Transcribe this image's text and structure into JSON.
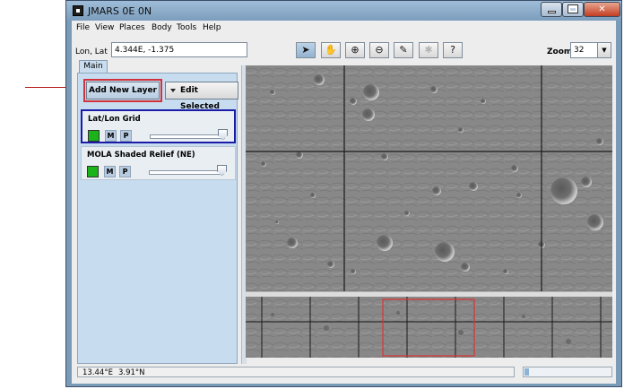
{
  "window": {
    "title": "JMARS 0E 0N"
  },
  "menubar": {
    "items": [
      "File",
      "View",
      "Places",
      "Body",
      "Tools",
      "Help"
    ]
  },
  "toolbar": {
    "lonlat_label": "Lon, Lat",
    "lonlat_value": "4.344E, -1.375",
    "tools": [
      "select-arrow",
      "pan-hand",
      "zoom-in",
      "zoom-out",
      "ruler",
      "disabled-tool",
      "info-query"
    ],
    "zoom_label": "Zoom:",
    "zoom_value": "32"
  },
  "panel": {
    "tab": "Main",
    "add_layer_label": "Add New Layer",
    "edit_selected_label": "Edit Selected",
    "layers": [
      {
        "name": "Lat/Lon Grid",
        "color": "#1ab41a",
        "m": "M",
        "p": "P",
        "opacity": 1.0,
        "selected": true
      },
      {
        "name": "MOLA Shaded Relief (NE)",
        "color": "#1ab41a",
        "m": "M",
        "p": "P",
        "opacity": 1.0,
        "selected": false
      }
    ]
  },
  "status": {
    "lon": "13.44°E",
    "lat": "3.91°N",
    "progress": 0.05
  },
  "colors": {
    "highlight": "#d2323c",
    "selection": "#1a1ca8",
    "overview_box": "#d43a3a"
  }
}
